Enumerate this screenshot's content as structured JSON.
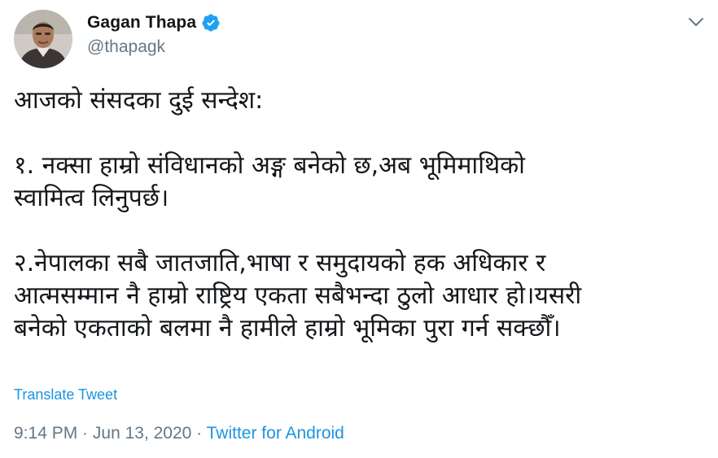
{
  "author": {
    "display_name": "Gagan Thapa",
    "handle": "@thapagk",
    "verified": true
  },
  "tweet": {
    "paragraph_1": "आजको संसदका दुई सन्देश:",
    "paragraph_2_line_1": "१. नक्सा हाम्रो संविधानको अङ्ग बनेको छ,अब भूमिमाथिको",
    "paragraph_2_line_2": "स्वामित्व लिनुपर्छ।",
    "paragraph_3_line_1": "२.नेपालका सबै जातजाति,भाषा र समुदायको हक अधिकार र",
    "paragraph_3_line_2": "आत्मसम्मान नै हाम्रो राष्ट्रिय एकता सबैभन्दा ठुलो आधार हो।यसरी",
    "paragraph_3_line_3": "बनेको एकताको बलमा नै हामीले हाम्रो भूमिका पुरा गर्न सक्छौँ।"
  },
  "translate_label": "Translate Tweet",
  "meta": {
    "time": "9:14 PM",
    "separator": " · ",
    "date": "Jun 13, 2020",
    "source": "Twitter for Android"
  },
  "colors": {
    "link": "#1b95e0",
    "secondary_text": "#657786",
    "primary_text": "#14171a",
    "verified_badge": "#1da1f2"
  },
  "icons": {
    "verified": "verified-badge-icon",
    "menu": "chevron-down-icon"
  }
}
